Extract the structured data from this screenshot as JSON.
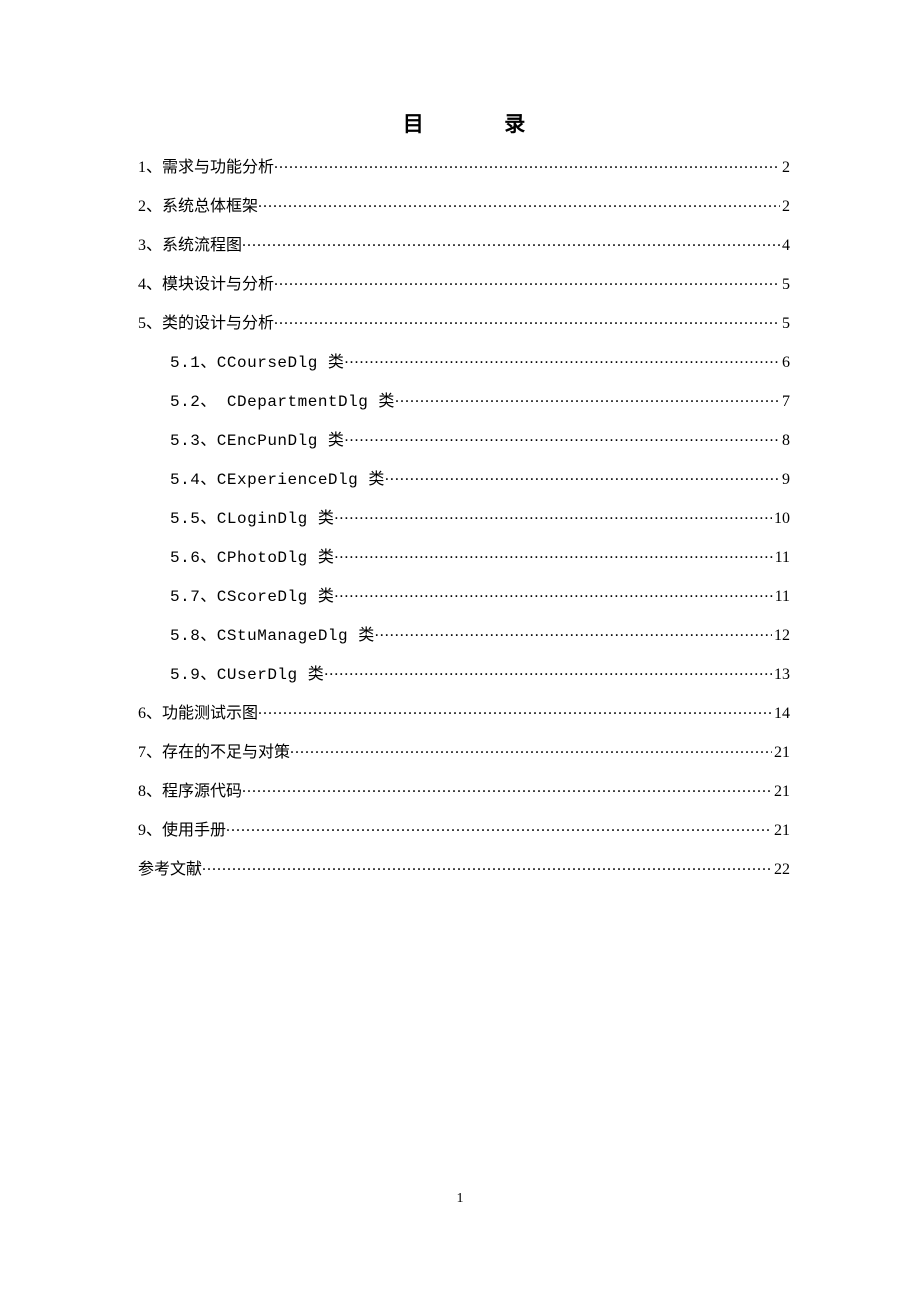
{
  "title": {
    "char1": "目",
    "char2": "录"
  },
  "toc": [
    {
      "label": "1、需求与功能分析",
      "page": "2",
      "indent": false,
      "mono": false
    },
    {
      "label": "2、系统总体框架",
      "page": "2",
      "indent": false,
      "mono": false
    },
    {
      "label": "3、系统流程图",
      "page": "4",
      "indent": false,
      "mono": false
    },
    {
      "label": "4、模块设计与分析",
      "page": "5",
      "indent": false,
      "mono": false
    },
    {
      "label": "5、类的设计与分析",
      "page": "5",
      "indent": false,
      "mono": false
    },
    {
      "label": "5.1、CCourseDlg 类",
      "page": "6",
      "indent": true,
      "mono": true
    },
    {
      "label": "5.2、 CDepartmentDlg 类",
      "page": "7",
      "indent": true,
      "mono": true
    },
    {
      "label": "5.3、CEncPunDlg 类",
      "page": "8",
      "indent": true,
      "mono": true
    },
    {
      "label": "5.4、CExperienceDlg 类",
      "page": "9",
      "indent": true,
      "mono": true
    },
    {
      "label": "5.5、CLoginDlg 类",
      "page": "10",
      "indent": true,
      "mono": true
    },
    {
      "label": "5.6、CPhotoDlg 类",
      "page": "11",
      "indent": true,
      "mono": true
    },
    {
      "label": "5.7、CScoreDlg 类",
      "page": "11",
      "indent": true,
      "mono": true
    },
    {
      "label": "5.8、CStuManageDlg 类",
      "page": "12",
      "indent": true,
      "mono": true
    },
    {
      "label": "5.9、CUserDlg 类",
      "page": "13",
      "indent": true,
      "mono": true
    },
    {
      "label": "6、功能测试示图",
      "page": "14",
      "indent": false,
      "mono": false
    },
    {
      "label": "7、存在的不足与对策",
      "page": "21",
      "indent": false,
      "mono": false
    },
    {
      "label": "8、程序源代码",
      "page": "21",
      "indent": false,
      "mono": false
    },
    {
      "label": "9、使用手册",
      "page": "21",
      "indent": false,
      "mono": false
    },
    {
      "label": "参考文献",
      "page": "22",
      "indent": false,
      "mono": false
    }
  ],
  "page_number": "1"
}
